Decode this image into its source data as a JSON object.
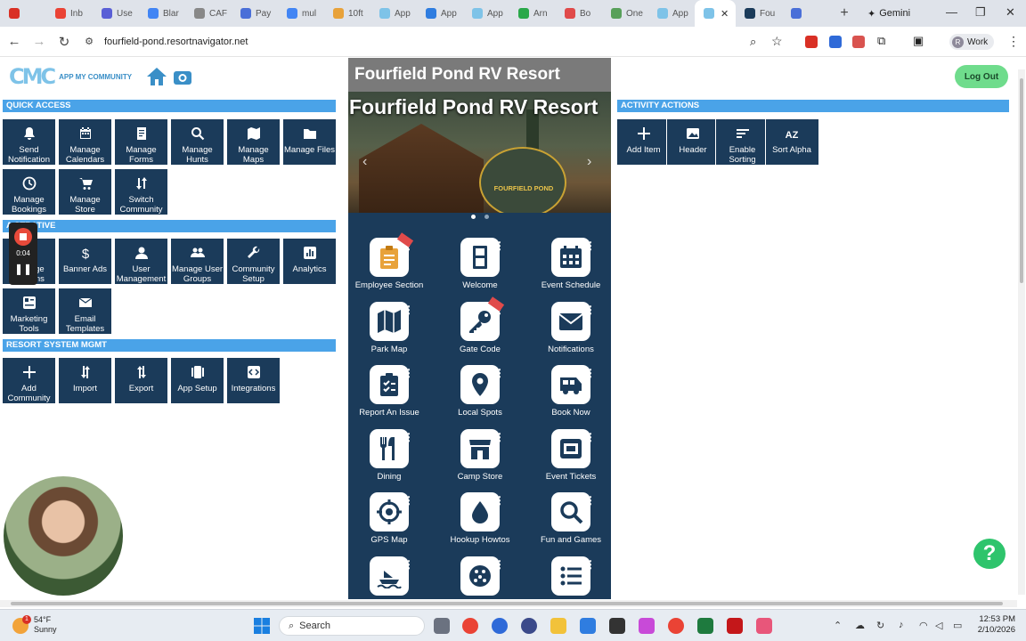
{
  "browser": {
    "tabs": [
      {
        "label": "",
        "color": "#d93025"
      },
      {
        "label": "Inb",
        "color": "#ea4335"
      },
      {
        "label": "Use",
        "color": "#5a5fd6"
      },
      {
        "label": "Blar",
        "color": "#4285f4"
      },
      {
        "label": "CAF",
        "color": "#888888"
      },
      {
        "label": "Pay",
        "color": "#4a6fd8"
      },
      {
        "label": "mul",
        "color": "#4285f4"
      },
      {
        "label": "10ft",
        "color": "#e8a23a"
      },
      {
        "label": "App",
        "color": "#7ec3e8"
      },
      {
        "label": "App",
        "color": "#2f7de0"
      },
      {
        "label": "App",
        "color": "#7ec3e8"
      },
      {
        "label": "Arn",
        "color": "#2aa84a"
      },
      {
        "label": "Bo",
        "color": "#e04a4a"
      },
      {
        "label": "One",
        "color": "#58a05a"
      },
      {
        "label": "App",
        "color": "#7ec3e8"
      }
    ],
    "active_tab": {
      "label": "",
      "close": "✕"
    },
    "after_tabs": [
      {
        "label": "Fou",
        "color": "#1b3b5a"
      },
      {
        "label": "",
        "color": "#4a6fd8"
      }
    ],
    "new_tab": "+",
    "gemini_label": "Gemini",
    "url": "fourfield-pond.resortnavigator.net",
    "profile_initial": "R",
    "profile_label": "Work"
  },
  "header": {
    "logo_mark": "CMC",
    "logo_text": "APP MY COMMUNITY",
    "logout_label": "Log Out"
  },
  "quick_access": {
    "title": "QUICK ACCESS",
    "tiles": [
      {
        "label": "Send Notification",
        "icon": "bell-icon"
      },
      {
        "label": "Manage Calendars",
        "icon": "calendar-icon"
      },
      {
        "label": "Manage Forms",
        "icon": "form-icon"
      },
      {
        "label": "Manage Hunts",
        "icon": "search-icon"
      },
      {
        "label": "Manage Maps",
        "icon": "map-icon"
      },
      {
        "label": "Manage Files",
        "icon": "folder-icon"
      },
      {
        "label": "Manage Bookings",
        "icon": "clock-icon"
      },
      {
        "label": "Manage Store",
        "icon": "cart-icon"
      },
      {
        "label": "Switch Community",
        "icon": "switch-icon"
      }
    ]
  },
  "administrative": {
    "title": "ADMINISTRATIVE",
    "title_visible": "A      STRATIVE",
    "tiles": [
      {
        "label": "S     e ns",
        "icon": "screens-icon",
        "visible_label": "Manage Screens"
      },
      {
        "label": "Banner Ads",
        "icon": "dollar-icon"
      },
      {
        "label": "User Management",
        "icon": "user-icon"
      },
      {
        "label": "Manage User Groups",
        "icon": "group-icon"
      },
      {
        "label": "Community Setup",
        "icon": "wrench-icon"
      },
      {
        "label": "Analytics",
        "icon": "analytics-icon"
      },
      {
        "label": "Marketing Tools",
        "icon": "marketing-icon"
      },
      {
        "label": "Email Templates",
        "icon": "email-icon"
      }
    ]
  },
  "resort_mgmt": {
    "title": "RESORT SYSTEM MGMT",
    "tiles": [
      {
        "label": "Add Community",
        "icon": "plus-icon"
      },
      {
        "label": "Import",
        "icon": "import-icon"
      },
      {
        "label": "Export",
        "icon": "export-icon"
      },
      {
        "label": "App Setup",
        "icon": "app-setup-icon"
      },
      {
        "label": "Integrations",
        "icon": "code-icon"
      }
    ]
  },
  "activity_actions": {
    "title": "ACTIVITY ACTIONS",
    "tiles": [
      {
        "label": "Add Item",
        "icon": "plus-icon"
      },
      {
        "label": "Header",
        "icon": "image-icon"
      },
      {
        "label": "Enable Sorting",
        "icon": "sort-icon"
      },
      {
        "label": "Sort Alpha",
        "icon": "sort-alpha-icon"
      }
    ]
  },
  "phone": {
    "top_title": "Fourfield Pond RV Resort",
    "hero_title": "Fourfield Pond RV Resort",
    "hero_badge": "FOURFIELD POND",
    "apps": [
      {
        "label": "Employee Section",
        "icon": "clipboard-icon",
        "ribbon": true
      },
      {
        "label": "Welcome",
        "icon": "door-icon"
      },
      {
        "label": "Event Schedule",
        "icon": "calendar-icon"
      },
      {
        "label": "Park Map",
        "icon": "map-icon"
      },
      {
        "label": "Gate Code",
        "icon": "key-icon",
        "ribbon": true
      },
      {
        "label": "Notifications",
        "icon": "envelope-icon"
      },
      {
        "label": "Report An Issue",
        "icon": "clipboard-check-icon"
      },
      {
        "label": "Local Spots",
        "icon": "pin-icon"
      },
      {
        "label": "Book Now",
        "icon": "camper-icon"
      },
      {
        "label": "Dining",
        "icon": "utensils-icon"
      },
      {
        "label": "Camp Store",
        "icon": "store-icon"
      },
      {
        "label": "Event Tickets",
        "icon": "ticket-icon"
      },
      {
        "label": "GPS Map",
        "icon": "crosshair-icon"
      },
      {
        "label": "Hookup Howtos",
        "icon": "drop-icon"
      },
      {
        "label": "Fun and Games",
        "icon": "search-icon"
      },
      {
        "label": "",
        "icon": "boat-icon"
      },
      {
        "label": "",
        "icon": "ball-icon"
      },
      {
        "label": "",
        "icon": "list-icon"
      }
    ],
    "kebab": "⋮"
  },
  "recorder": {
    "time": "0:04"
  },
  "taskbar": {
    "weather_temp": "54°F",
    "weather_desc": "Sunny",
    "weather_badge": "1",
    "search_label": "Search",
    "time": "12:53 PM",
    "date": "2/10/2026"
  }
}
